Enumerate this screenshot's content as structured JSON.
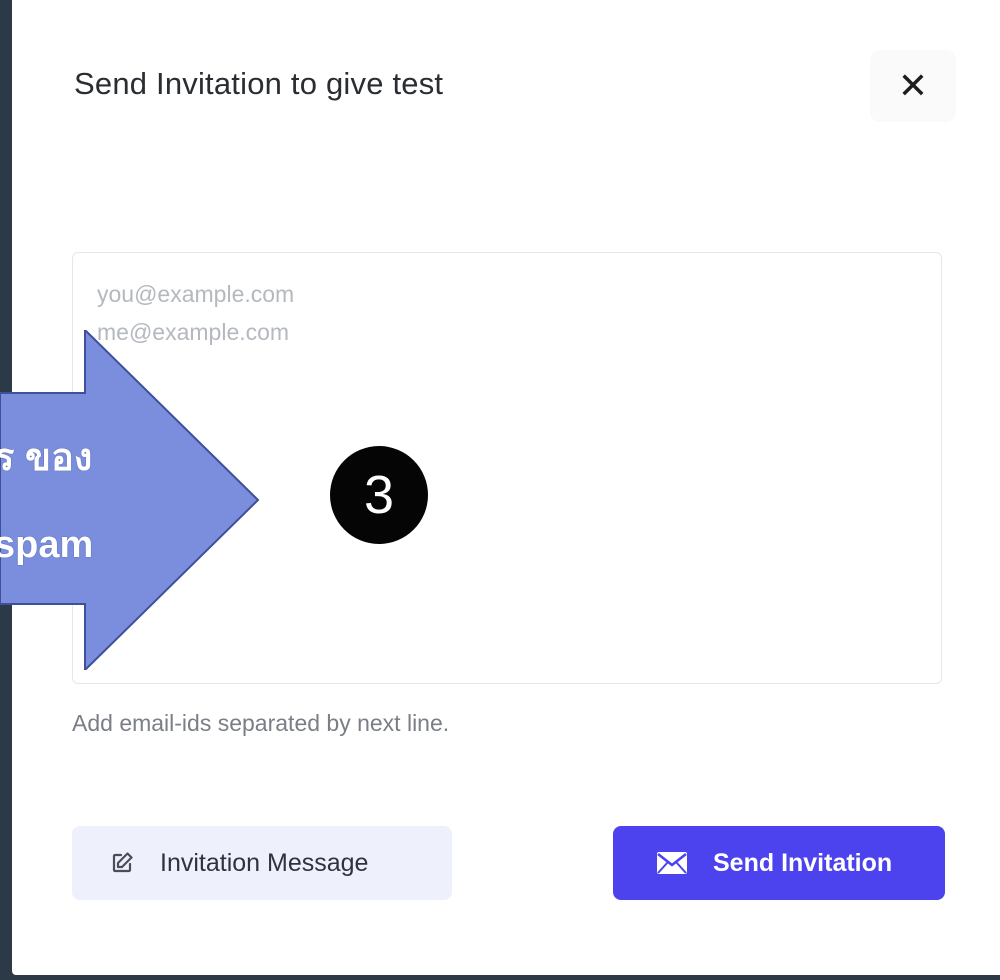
{
  "modal": {
    "title": "Send Invitation to give test",
    "close_symbol": "✕",
    "email_placeholder": "you@example.com\nme@example.com",
    "help_text": "Add email-ids separated by next line.",
    "buttons": {
      "invitation_message": "Invitation Message",
      "send_invitation": "Send Invitation"
    }
  },
  "annotation": {
    "arrow_line1": "ร ของ",
    "arrow_line2": "spam",
    "step_number": "3"
  },
  "colors": {
    "primary": "#4c43ee",
    "secondary_bg": "#eef0fc",
    "arrow_fill": "#7b8ede",
    "backdrop": "#2c3a48"
  },
  "icons": [
    "close-icon",
    "edit-icon",
    "mail-icon"
  ]
}
